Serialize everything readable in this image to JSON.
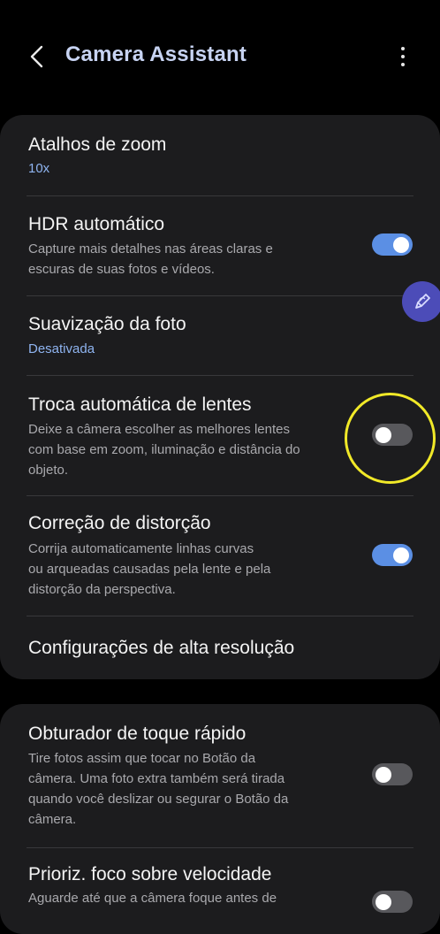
{
  "header": {
    "back_icon": "chevron-left-icon",
    "title": "Camera Assistant",
    "more_icon": "more-vertical-icon"
  },
  "settings": {
    "zoom_shortcuts": {
      "title": "Atalhos de zoom",
      "value": "10x"
    },
    "auto_hdr": {
      "title": "HDR automático",
      "line1": "Capture mais detalhes nas áreas claras e",
      "line2": "escuras de suas fotos e vídeos.",
      "enabled": true
    },
    "photo_smoothing": {
      "title": "Suavização da foto",
      "value": "Desativada"
    },
    "auto_lens_switch": {
      "title": "Troca automática de lentes",
      "line1": "Deixe a câmera escolher as melhores lentes",
      "line2": "com base em zoom, iluminação e distância do",
      "line3": "objeto.",
      "enabled": false
    },
    "distortion_correction": {
      "title": "Correção de distorção",
      "line1": "Corrija automaticamente linhas curvas",
      "line2": "ou arqueadas causadas pela lente e pela",
      "line3": "distorção da perspectiva.",
      "enabled": true
    },
    "high_res": {
      "title": "Configurações de alta resolução"
    },
    "quick_tap_shutter": {
      "title": "Obturador de toque rápido",
      "line1": "Tire fotos assim que tocar no Botão da",
      "line2": "câmera. Uma foto extra também será tirada",
      "line3": "quando você deslizar ou segurar o Botão da",
      "line4": "câmera.",
      "enabled": false
    },
    "focus_priority": {
      "title": "Prioriz. foco sobre velocidade",
      "line1": "Aguarde até que a câmera foque antes de",
      "enabled": false
    }
  },
  "colors": {
    "accent": "#5b8fe4",
    "highlight_ring": "#f1e928",
    "floating_button": "#4c4cb8",
    "value_text": "#8fb4f0"
  },
  "floating_button_icon": "pen-icon"
}
